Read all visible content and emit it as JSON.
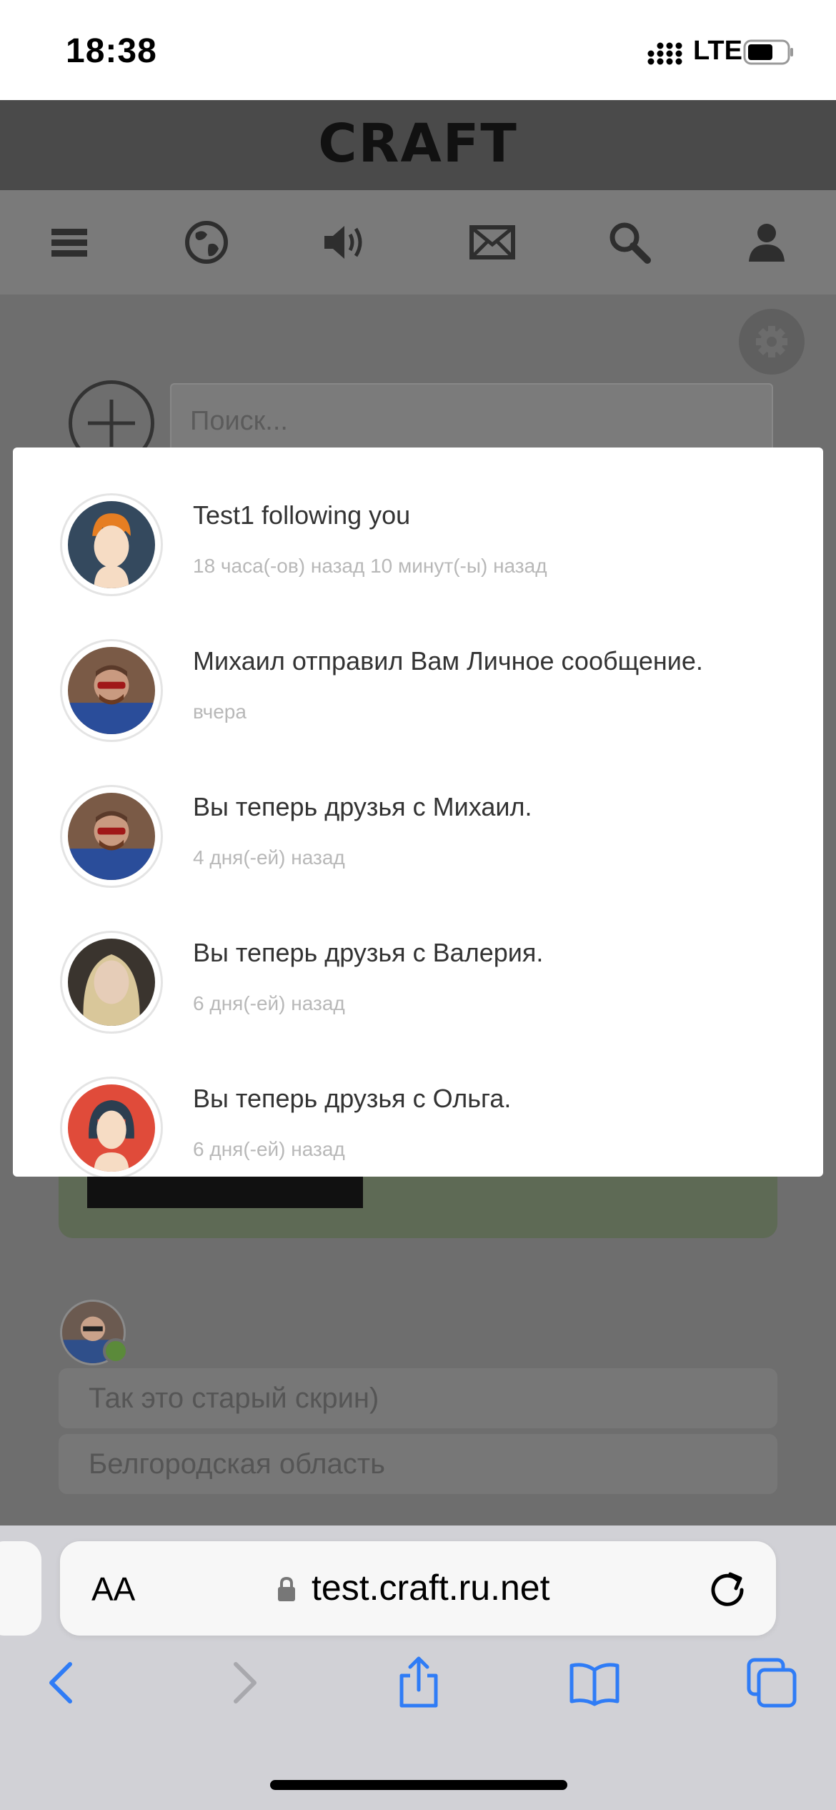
{
  "status_bar": {
    "time": "18:38",
    "network": "LTE"
  },
  "site": {
    "logo_text": "CRAFT"
  },
  "nav": {
    "icons": [
      "menu-icon",
      "globe-icon",
      "speaker-icon",
      "mail-icon",
      "search-icon",
      "user-icon"
    ]
  },
  "search": {
    "placeholder": "Поиск..."
  },
  "notifications": [
    {
      "title": "Test1 following you",
      "time": "18 часа(-ов) назад 10 минут(-ы) назад"
    },
    {
      "title": "Михаил отправил Вам Личное сообщение.",
      "time": "вчера"
    },
    {
      "title": "Вы теперь друзья с Михаил.",
      "time": "4 дня(-ей) назад"
    },
    {
      "title": "Вы теперь друзья с Валерия.",
      "time": "6 дня(-ей) назад"
    },
    {
      "title": "Вы теперь друзья с Ольга.",
      "time": "6 дня(-ей) назад"
    }
  ],
  "post": {
    "comment": "Так это старый скрин)",
    "location": "Белгородская область"
  },
  "browser": {
    "text_size_label": "AA",
    "url": "test.craft.ru.net"
  }
}
